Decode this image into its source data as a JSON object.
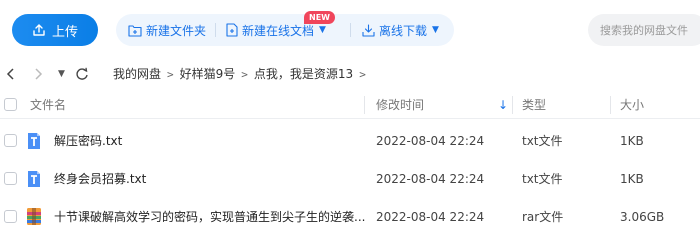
{
  "toolbar": {
    "upload_label": "上传",
    "new_folder_label": "新建文件夹",
    "new_online_doc_label": "新建在线文档",
    "new_badge": "NEW",
    "offline_download_label": "离线下载",
    "search_placeholder": "搜索我的网盘文件"
  },
  "breadcrumb": {
    "items": [
      "我的网盘",
      "好样猫9号",
      "点我，我是资源13"
    ]
  },
  "table": {
    "columns": {
      "name": "文件名",
      "modified": "修改时间",
      "type": "类型",
      "size": "大小"
    },
    "sort_indicator": "↓",
    "rows": [
      {
        "name": "解压密码.txt",
        "modified": "2022-08-04 22:24",
        "type": "txt文件",
        "size": "1KB",
        "icon": "txt-file-icon"
      },
      {
        "name": "终身会员招募.txt",
        "modified": "2022-08-04 22:24",
        "type": "txt文件",
        "size": "1KB",
        "icon": "txt-file-icon"
      },
      {
        "name": "十节课破解高效学习的密码，实现普通生到尖子生的逆袭...",
        "modified": "2022-08-04 22:24",
        "type": "rar文件",
        "size": "3.06GB",
        "icon": "rar-file-icon"
      }
    ]
  },
  "colors": {
    "accent": "#1a73e8",
    "upload_button": "#0a7ee6",
    "badge": "#f0455b",
    "txt_icon": "#4a8ff6"
  }
}
